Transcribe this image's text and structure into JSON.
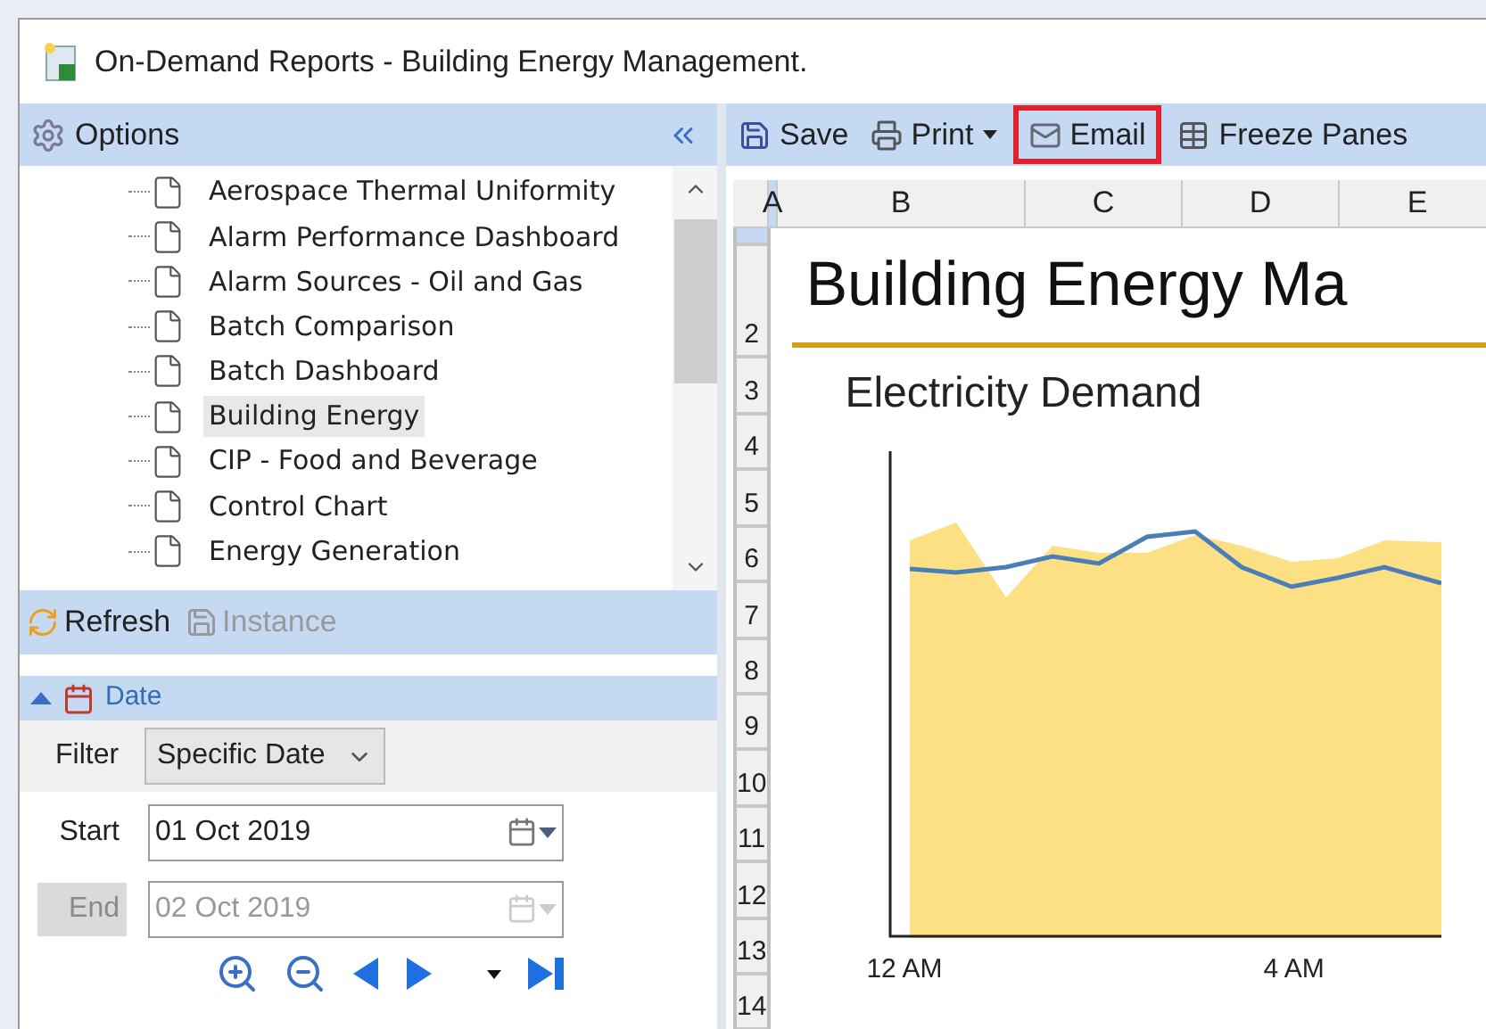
{
  "window": {
    "title": "On-Demand Reports - Building Energy Management."
  },
  "options_panel": {
    "title": "Options",
    "tree_items": [
      {
        "label": "Aerospace Thermal Uniformity",
        "selected": false
      },
      {
        "label": "Alarm Performance Dashboard",
        "selected": false
      },
      {
        "label": "Alarm Sources - Oil and Gas",
        "selected": false
      },
      {
        "label": "Batch Comparison",
        "selected": false
      },
      {
        "label": "Batch Dashboard",
        "selected": false
      },
      {
        "label": "Building Energy",
        "selected": true
      },
      {
        "label": "CIP - Food and Beverage",
        "selected": false
      },
      {
        "label": "Control Chart",
        "selected": false
      },
      {
        "label": "Energy Generation",
        "selected": false
      }
    ],
    "actions": [
      {
        "kind": "refresh",
        "label": "Refresh",
        "disabled": false
      },
      {
        "kind": "instance",
        "label": "Instance",
        "disabled": true
      }
    ],
    "date_section": {
      "title": "Date",
      "expanded": true,
      "filter": {
        "label": "Filter",
        "value": "Specific Date"
      },
      "start": {
        "label": "Start",
        "value": "01 Oct 2019",
        "disabled": false
      },
      "end": {
        "label": "End",
        "value": "02 Oct 2019",
        "disabled": true
      }
    }
  },
  "toolbar": [
    {
      "kind": "save",
      "label": "Save",
      "highlighted": false
    },
    {
      "kind": "print",
      "label": "Print",
      "highlighted": false
    },
    {
      "kind": "email",
      "label": "Email",
      "highlighted": true
    },
    {
      "kind": "freeze",
      "label": "Freeze Panes",
      "highlighted": false
    }
  ],
  "sheet": {
    "columns": [
      {
        "label": "A",
        "selected": true
      },
      {
        "label": "B",
        "selected": false
      },
      {
        "label": "C",
        "selected": false
      },
      {
        "label": "D",
        "selected": false
      },
      {
        "label": "E",
        "selected": false
      }
    ],
    "rows": [
      {
        "selected": true
      },
      {
        "label": "2",
        "selected": false
      },
      {
        "label": "3",
        "selected": false
      },
      {
        "label": "4",
        "selected": false
      },
      {
        "label": "5",
        "selected": false
      },
      {
        "label": "6",
        "selected": false
      },
      {
        "label": "7",
        "selected": false
      },
      {
        "label": "8",
        "selected": false
      },
      {
        "label": "9",
        "selected": false
      },
      {
        "label": "10",
        "selected": false
      },
      {
        "label": "11",
        "selected": false
      },
      {
        "label": "12",
        "selected": false
      },
      {
        "label": "13",
        "selected": false
      },
      {
        "label": "14",
        "selected": false
      }
    ],
    "report_title": "Building Energy Ma",
    "chart_title": "Electricity Demand",
    "x_labels": [
      "12 AM",
      "4 AM"
    ]
  }
}
